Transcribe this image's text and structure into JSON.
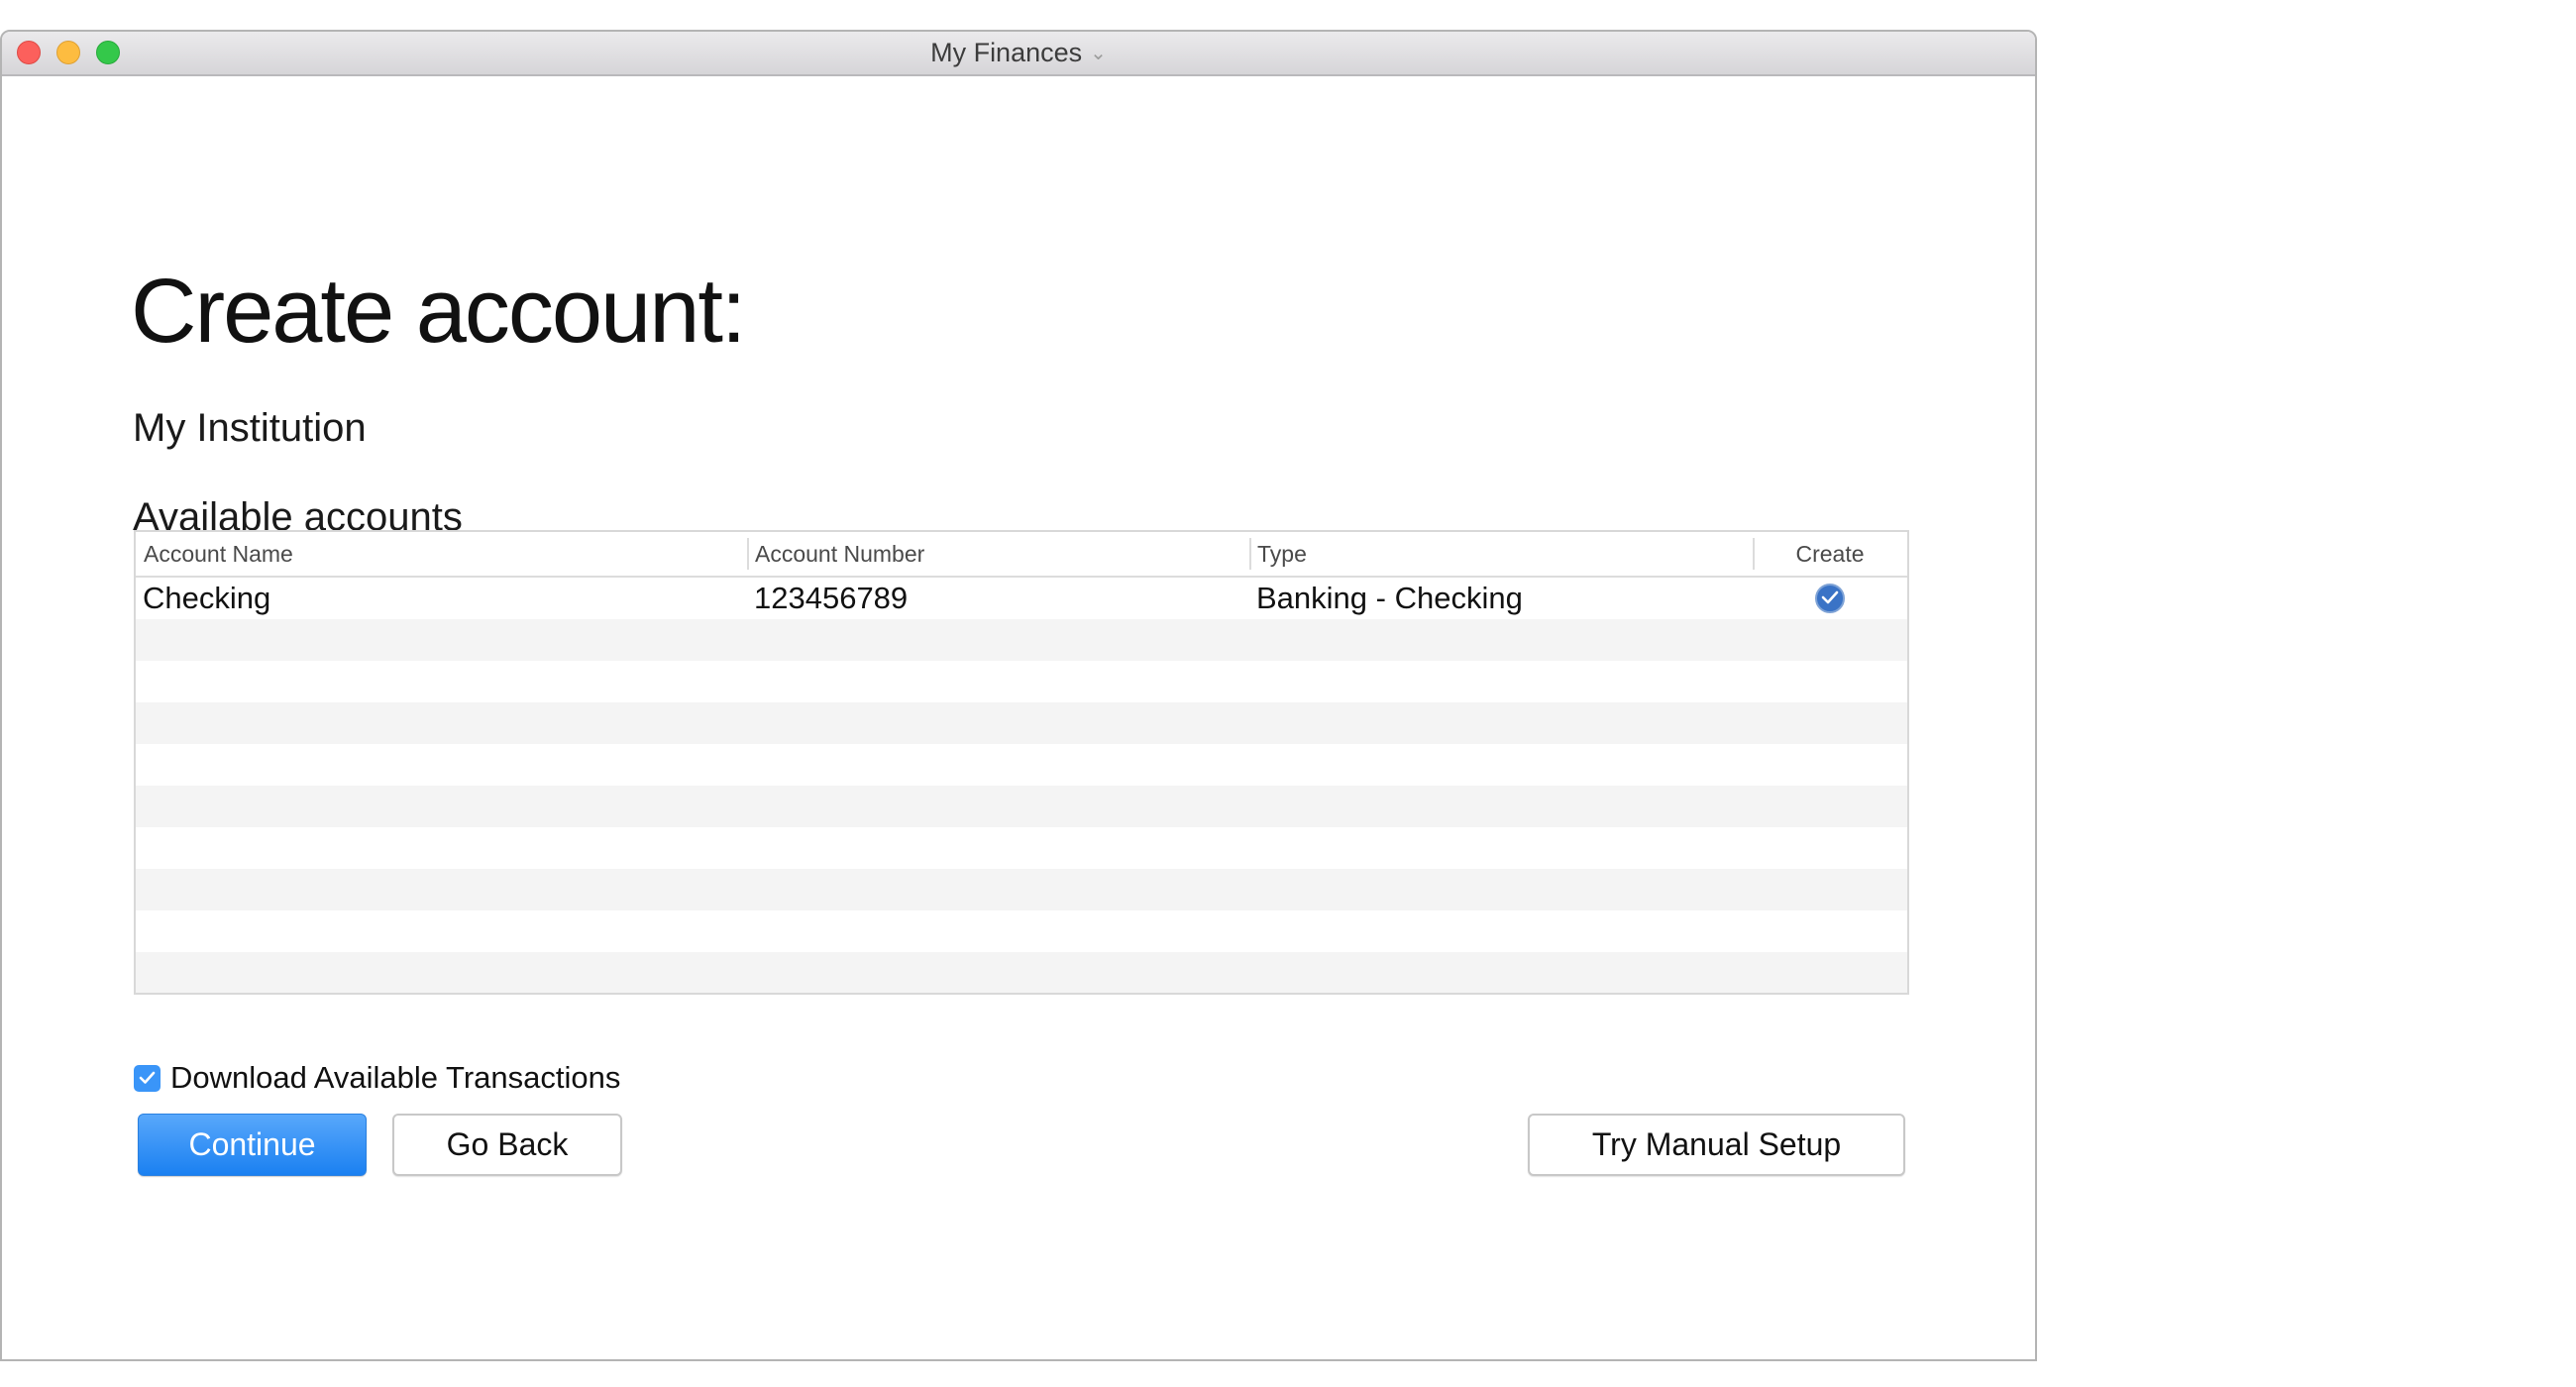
{
  "window": {
    "title": "My Finances",
    "title_menu_icon": "chevron-down-icon",
    "controls": [
      "close",
      "minimize",
      "maximize"
    ],
    "colors": {
      "close": "#fc605c",
      "minimize": "#fdbc40",
      "maximize": "#34c84a"
    }
  },
  "page": {
    "heading": "Create account:",
    "institution": "My Institution",
    "section_title": "Available accounts"
  },
  "table": {
    "columns": [
      "Account Name",
      "Account Number",
      "Type",
      "Create"
    ],
    "rows": [
      {
        "account_name": "Checking",
        "account_number": "123456789",
        "type": "Banking - Checking",
        "create": true
      }
    ],
    "empty_rows": 9
  },
  "options": {
    "download_label": "Download Available Transactions",
    "download_checked": true
  },
  "buttons": {
    "continue": "Continue",
    "go_back": "Go Back",
    "manual_setup": "Try Manual Setup"
  },
  "colors": {
    "accent": "#1a80f1",
    "checkbox": "#3a95f8",
    "create_check": "#3a73c6",
    "row_stripe": "#f4f4f4"
  }
}
